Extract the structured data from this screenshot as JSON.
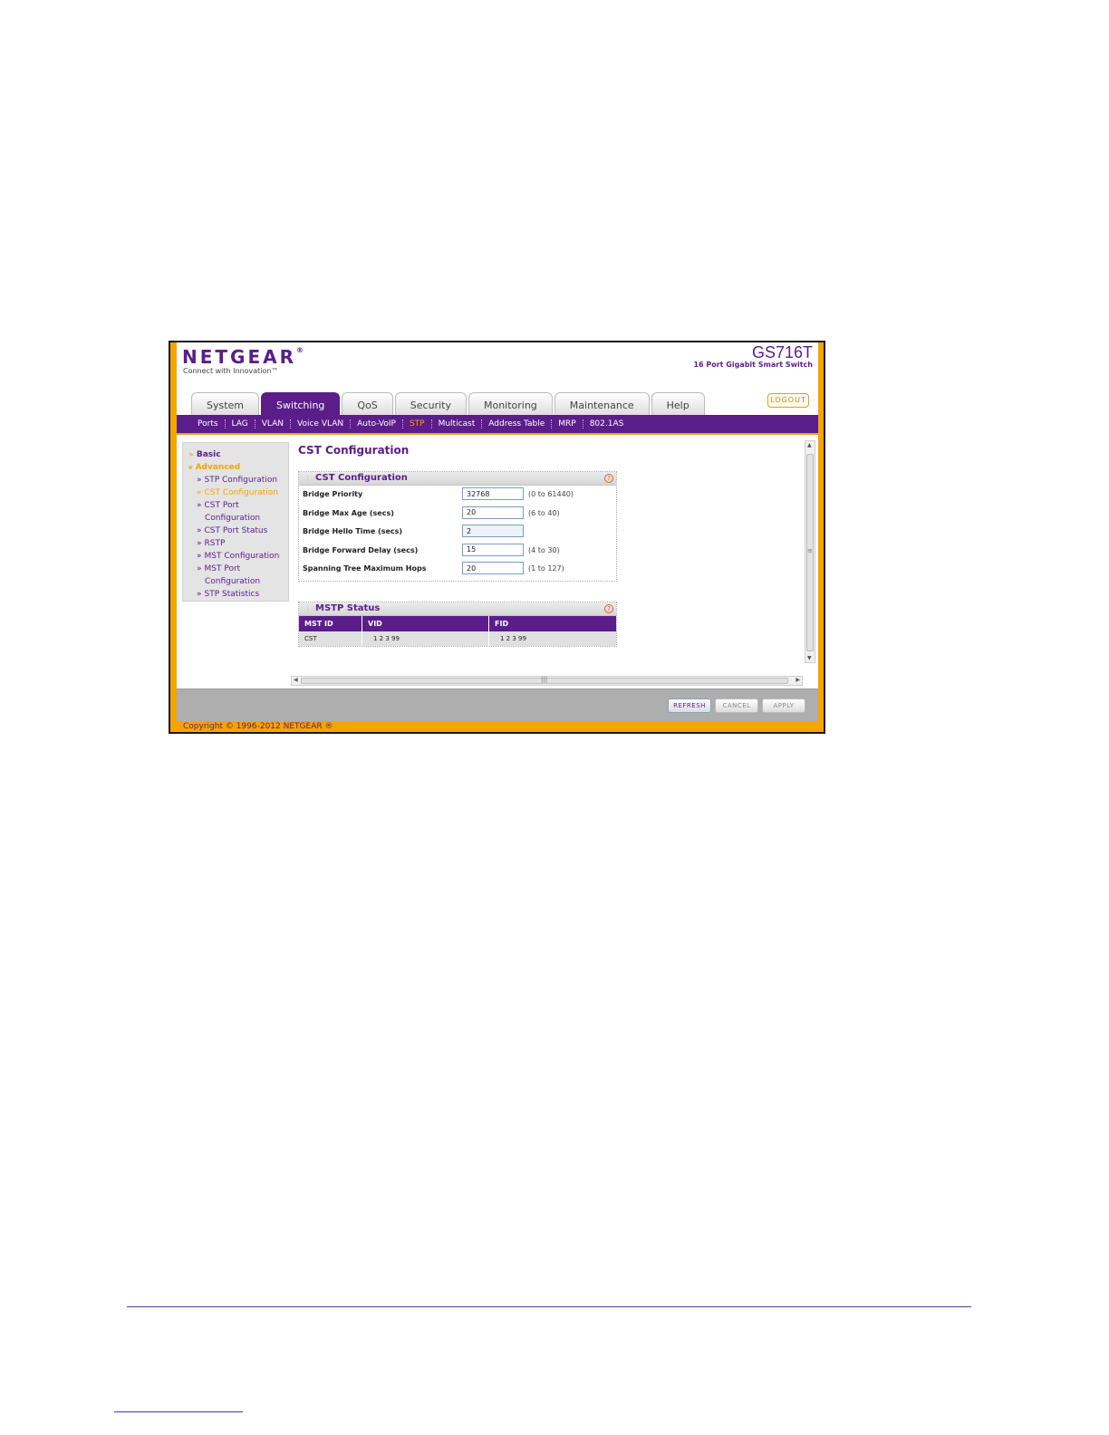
{
  "header": {
    "logo": "NETGEAR",
    "tagline": "Connect with Innovation™",
    "model": "GS716T",
    "model_desc": "16 Port Gigabit Smart Switch",
    "logout": "LOGOUT"
  },
  "tabs": [
    {
      "label": "System"
    },
    {
      "label": "Switching",
      "active": true
    },
    {
      "label": "QoS"
    },
    {
      "label": "Security"
    },
    {
      "label": "Monitoring"
    },
    {
      "label": "Maintenance"
    },
    {
      "label": "Help"
    }
  ],
  "subnav": [
    "Ports",
    "LAG",
    "VLAN",
    "Voice VLAN",
    "Auto-VoIP",
    "STP",
    "Multicast",
    "Address Table",
    "MRP",
    "802.1AS"
  ],
  "subnav_active": "STP",
  "menu": {
    "basic": "Basic",
    "advanced": "Advanced",
    "items": [
      {
        "label": "STP Configuration"
      },
      {
        "label": "CST Configuration",
        "active": true
      },
      {
        "label": "CST Port",
        "cont": "Configuration"
      },
      {
        "label": "CST Port Status"
      },
      {
        "label": "RSTP"
      },
      {
        "label": "MST Configuration"
      },
      {
        "label": "MST Port",
        "cont": "Configuration"
      },
      {
        "label": "STP Statistics"
      }
    ]
  },
  "page_title": "CST Configuration",
  "cst_panel": {
    "title": "CST Configuration",
    "fields": [
      {
        "label": "Bridge Priority",
        "value": "32768",
        "range": "(0 to 61440)"
      },
      {
        "label": "Bridge Max Age (secs)",
        "value": "20",
        "range": "(6 to 40)"
      },
      {
        "label": "Bridge Hello Time (secs)",
        "value": "2",
        "range": ""
      },
      {
        "label": "Bridge Forward Delay (secs)",
        "value": "15",
        "range": "(4 to 30)"
      },
      {
        "label": "Spanning Tree Maximum Hops",
        "value": "20",
        "range": "(1 to 127)"
      }
    ]
  },
  "mstp_panel": {
    "title": "MSTP Status",
    "columns": [
      "MST ID",
      "VID",
      "FID"
    ],
    "rows": [
      [
        "CST",
        "1 2 3 99",
        "1 2 3 99"
      ]
    ]
  },
  "buttons": {
    "refresh": "REFRESH",
    "cancel": "CANCEL",
    "apply": "APPLY"
  },
  "copyright": "Copyright © 1996-2012 NETGEAR ®",
  "colors": {
    "brand_purple": "#5a1d8a",
    "accent_orange": "#f5a400"
  }
}
